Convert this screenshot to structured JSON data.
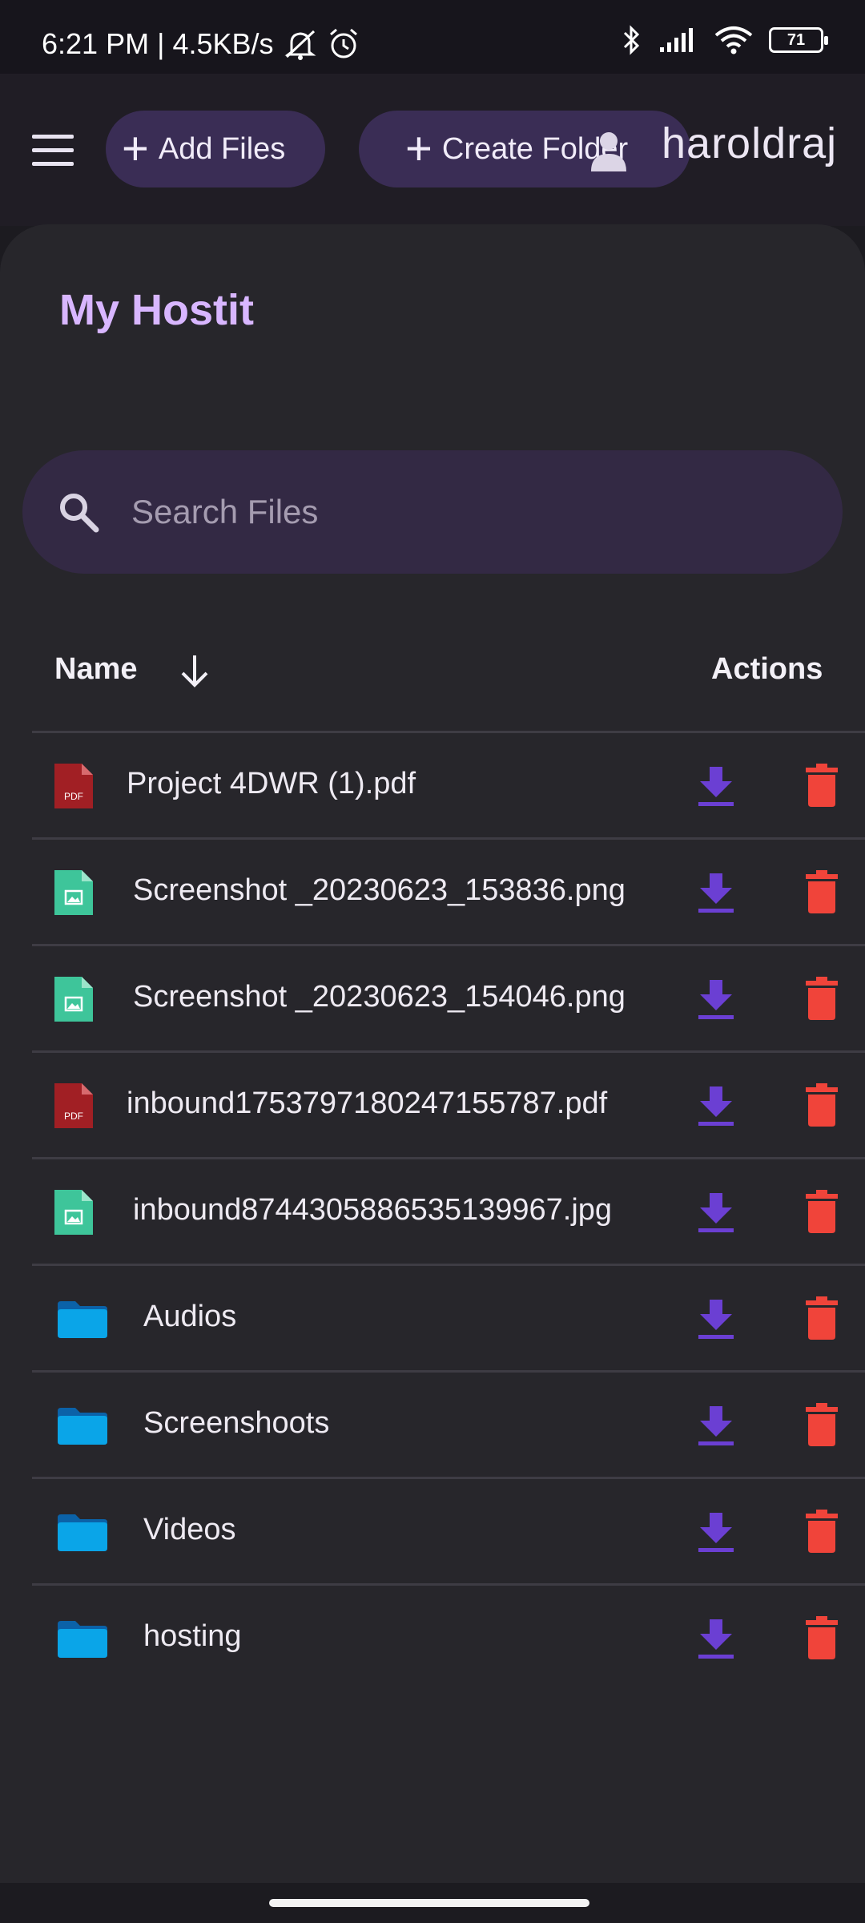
{
  "status": {
    "time": "6:21 PM",
    "separator": "|",
    "network_speed": "4.5KB/s",
    "battery": "71"
  },
  "header": {
    "add_files_label": "Add Files",
    "create_folder_label": "Create Folder",
    "username": "haroldraj"
  },
  "page": {
    "title": "My Hostit"
  },
  "search": {
    "placeholder": "Search Files",
    "value": ""
  },
  "table": {
    "name_header": "Name",
    "actions_header": "Actions",
    "rows": [
      {
        "name": "Project 4DWR (1).pdf",
        "type": "pdf"
      },
      {
        "name": "Screenshot _20230623_153836.png",
        "type": "image"
      },
      {
        "name": "Screenshot _20230623_154046.png",
        "type": "image"
      },
      {
        "name": "inbound1753797180247155787.pdf",
        "type": "pdf"
      },
      {
        "name": "inbound8744305886535139967.jpg",
        "type": "image"
      },
      {
        "name": "Audios",
        "type": "folder"
      },
      {
        "name": "Screenshoots",
        "type": "folder"
      },
      {
        "name": "Videos",
        "type": "folder"
      },
      {
        "name": "hosting",
        "type": "folder"
      }
    ]
  },
  "icons": {
    "pdf_badge": "PDF",
    "pdf_color": "#a11f24",
    "image_color": "#3ec59a",
    "folder_color": "#0aa5e8",
    "download_color": "#6b3fd3",
    "delete_color": "#f0443a"
  }
}
